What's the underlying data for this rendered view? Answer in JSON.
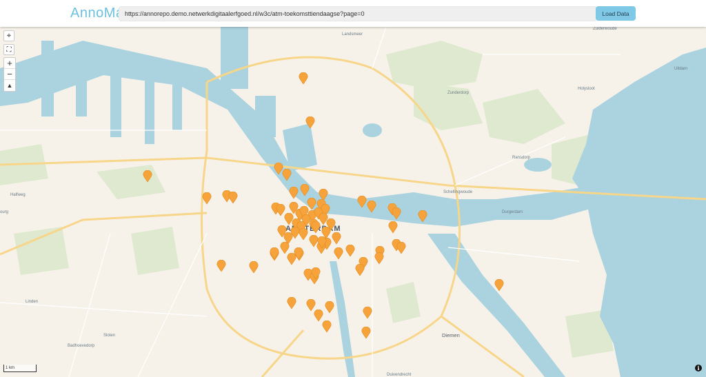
{
  "app": {
    "title": "AnnoMap"
  },
  "toolbar": {
    "url_value": "https://annorepo.demo.netwerkdigitaalerfgoed.nl/w3c/atm-toekomsttiendaagse?page=0",
    "load_label": "Load Data"
  },
  "map_controls": {
    "locate_icon": "crosshair-icon",
    "fullscreen_icon": "fullscreen-icon",
    "zoom_in": "+",
    "zoom_out": "−",
    "compass_icon": "compass-icon"
  },
  "scale_label": "1 km",
  "info_glyph": "i",
  "colors": {
    "marker": "#f5a33a",
    "water": "#aad3df",
    "land": "#f6f2ea",
    "accent": "#7fc9e6"
  },
  "labels": [
    {
      "id": "amsterdam",
      "text": "AMSTERDAM",
      "cls": "big"
    },
    {
      "id": "landsmeer",
      "text": "Landsmeer",
      "cls": ""
    },
    {
      "id": "zuiderwoude",
      "text": "Zuiderwoude",
      "cls": ""
    },
    {
      "id": "uitdam",
      "text": "Uitdam",
      "cls": ""
    },
    {
      "id": "holysloot",
      "text": "Holysloot",
      "cls": ""
    },
    {
      "id": "zunderdorp",
      "text": "Zunderdorp",
      "cls": ""
    },
    {
      "id": "ransdorp",
      "text": "Ransdorp",
      "cls": ""
    },
    {
      "id": "schellingwoude",
      "text": "Schellingwoude",
      "cls": ""
    },
    {
      "id": "durgerdam",
      "text": "Durgerdam",
      "cls": ""
    },
    {
      "id": "halfweg",
      "text": "Halfweg",
      "cls": ""
    },
    {
      "id": "linden",
      "text": "Linden",
      "cls": ""
    },
    {
      "id": "badhoevedorp",
      "text": "Badhoevedorp",
      "cls": ""
    },
    {
      "id": "sloten",
      "text": "Sloten",
      "cls": ""
    },
    {
      "id": "diemen",
      "text": "Diemen",
      "cls": "mid"
    },
    {
      "id": "duivendrecht",
      "text": "Duivendrecht",
      "cls": ""
    },
    {
      "id": "bourg",
      "text": "ourg",
      "cls": ""
    }
  ],
  "marker_count": 72
}
